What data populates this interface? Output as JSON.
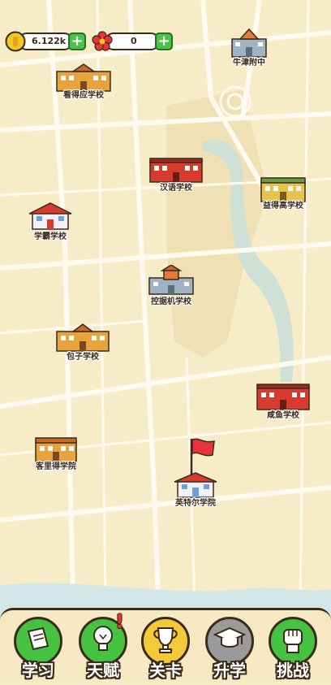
{
  "hud": {
    "coins_value": "6.122k",
    "flowers_value": "0",
    "coin_icon": "coin-icon",
    "flower_icon": "flower-icon"
  },
  "schools": [
    {
      "label": "牛津附中"
    },
    {
      "label": "看得应学校"
    },
    {
      "label": "汉语学校"
    },
    {
      "label": "益得高学校"
    },
    {
      "label": "学霸学校"
    },
    {
      "label": "控据机学校"
    },
    {
      "label": "包子学校"
    },
    {
      "label": "咸鱼学校"
    },
    {
      "label": "客里得学院"
    },
    {
      "label": "英特尔学院"
    }
  ],
  "nav": [
    {
      "label": "学习",
      "icon": "book-icon",
      "color": "#45c23f"
    },
    {
      "label": "天赋",
      "icon": "lightbulb-icon",
      "color": "#45c23f",
      "alert": "!"
    },
    {
      "label": "关卡",
      "icon": "trophy-icon",
      "color": "#f4c93a"
    },
    {
      "label": "升学",
      "icon": "graduation-cap-icon",
      "color": "#9a9a9a"
    },
    {
      "label": "挑战",
      "icon": "fist-icon",
      "color": "#45c23f"
    }
  ]
}
